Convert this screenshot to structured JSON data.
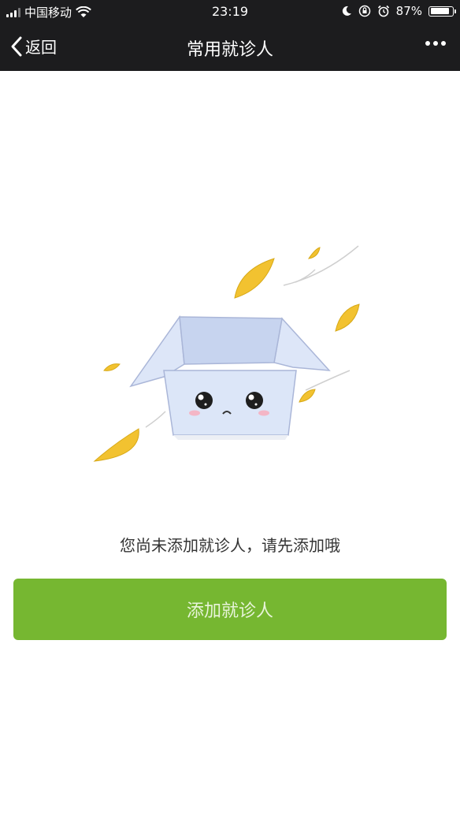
{
  "status_bar": {
    "carrier": "中国移动",
    "time": "23:19",
    "battery_text": "87%",
    "battery_level": 0.87,
    "icons": [
      "signal-icon",
      "wifi-icon",
      "moon-icon",
      "rotation-lock-icon",
      "alarm-icon",
      "battery-icon"
    ]
  },
  "nav": {
    "back_label": "返回",
    "title": "常用就诊人",
    "more_icon": "more-icon"
  },
  "empty_state": {
    "illustration": "empty-box-icon",
    "message": "您尚未添加就诊人，请先添加哦"
  },
  "actions": {
    "add_label": "添加就诊人"
  },
  "colors": {
    "bar_bg": "#1c1c1e",
    "button_green": "#76b731",
    "leaf_yellow": "#f2c230"
  }
}
